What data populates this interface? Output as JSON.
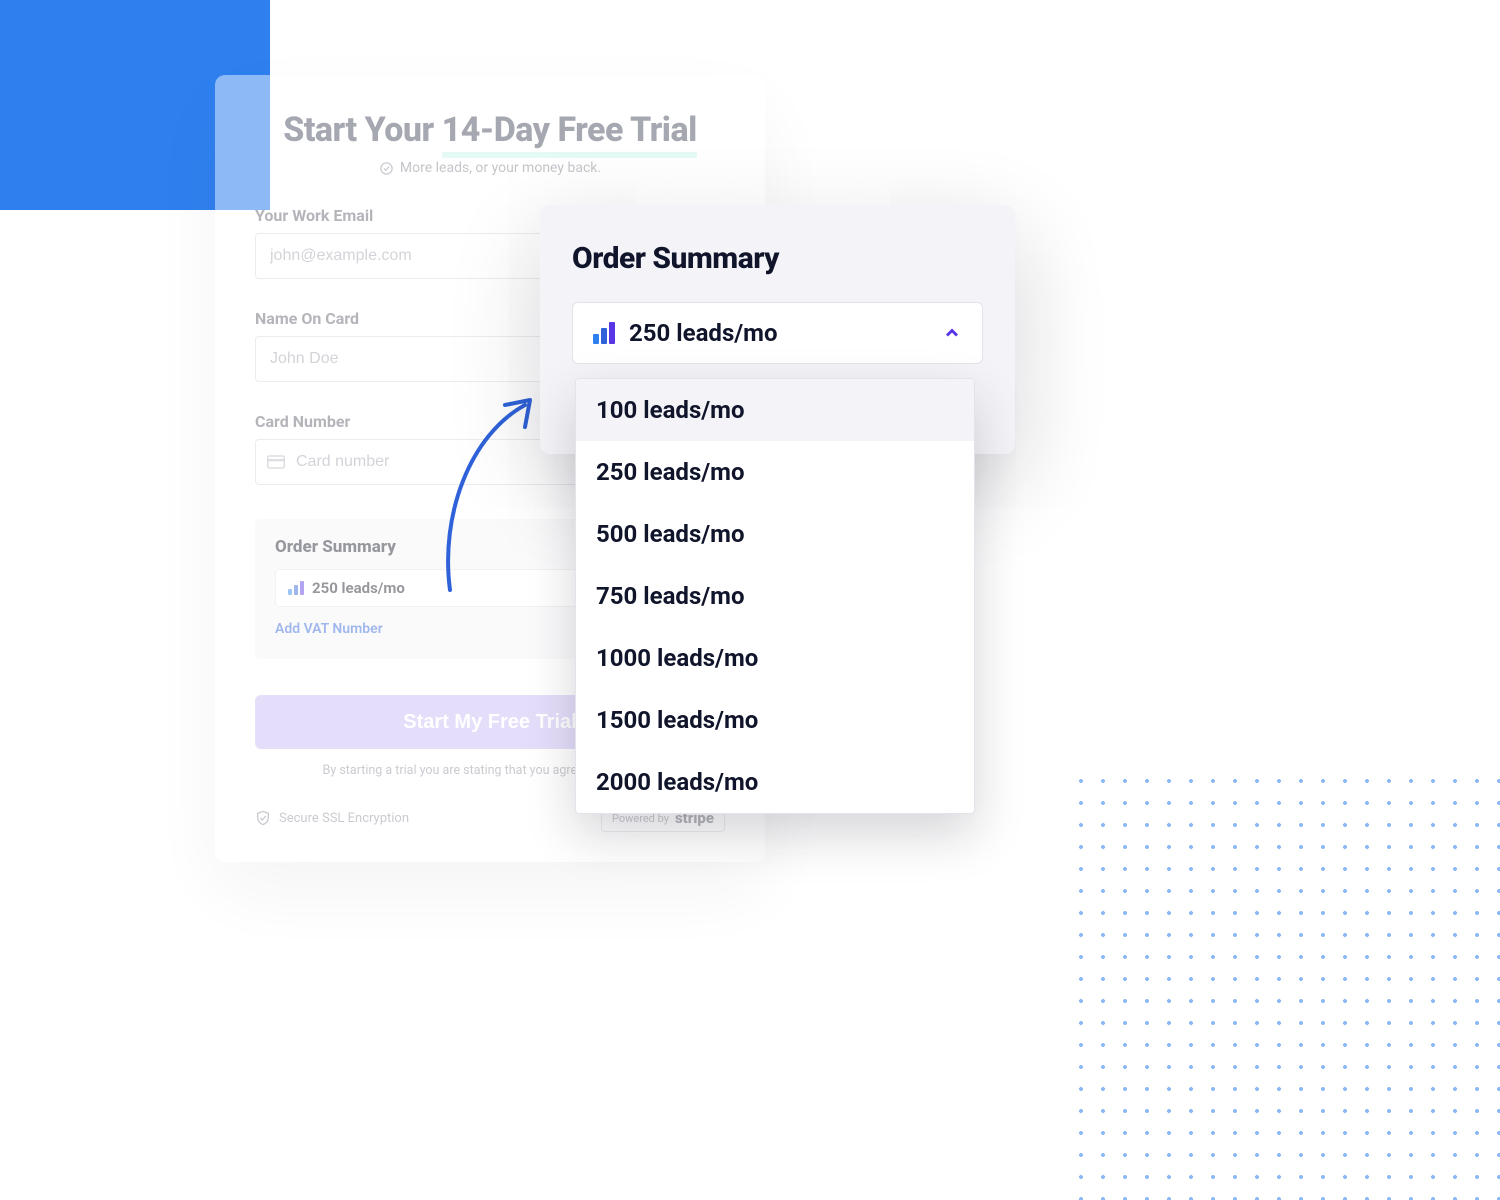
{
  "card": {
    "title_plain": "Start Your ",
    "title_highlight": "14-Day Free Trial",
    "subtitle": "More leads, or your money back.",
    "email_label": "Your Work Email",
    "email_placeholder": "john@example.com",
    "name_label": "Name On Card",
    "name_placeholder": "John Doe",
    "card_label": "Card Number",
    "card_placeholder": "Card number",
    "summary_title": "Order Summary",
    "plan_selected": "250 leads/mo",
    "vat_link": "Add VAT Number",
    "cta_label": "Start My Free Trial",
    "legal": "By starting a trial you are stating that you agree to the terms.",
    "ssl_text": "Secure SSL Encryption",
    "stripe_prefix": "Powered by",
    "stripe_brand": "stripe"
  },
  "panel": {
    "title": "Order Summary",
    "selected": "250 leads/mo"
  },
  "dropdown": {
    "options": [
      "100 leads/mo",
      "250 leads/mo",
      "500 leads/mo",
      "750 leads/mo",
      "1000 leads/mo",
      "1500 leads/mo",
      "2000 leads/mo"
    ]
  }
}
